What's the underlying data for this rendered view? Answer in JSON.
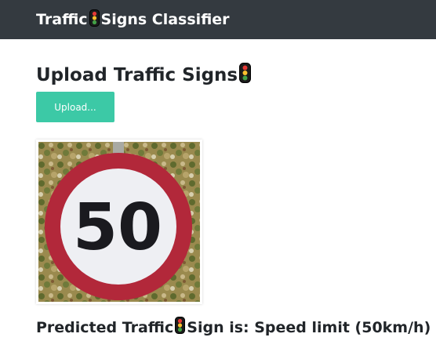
{
  "navbar": {
    "title_part1": "Traffic",
    "title_part2": "Signs Classifier",
    "icon": "traffic-light-icon"
  },
  "main": {
    "heading": "Upload Traffic Signs",
    "heading_icon": "traffic-light-icon",
    "upload_label": "Upload...",
    "image_sign_text": "50",
    "result_prefix": "Predicted Traffic",
    "result_suffix": "Sign is: Speed limit (50km/h)"
  },
  "colors": {
    "navbar_bg": "#343a40",
    "button_bg": "#3cc9a6",
    "sign_red": "#b2283a",
    "text": "#212529"
  }
}
